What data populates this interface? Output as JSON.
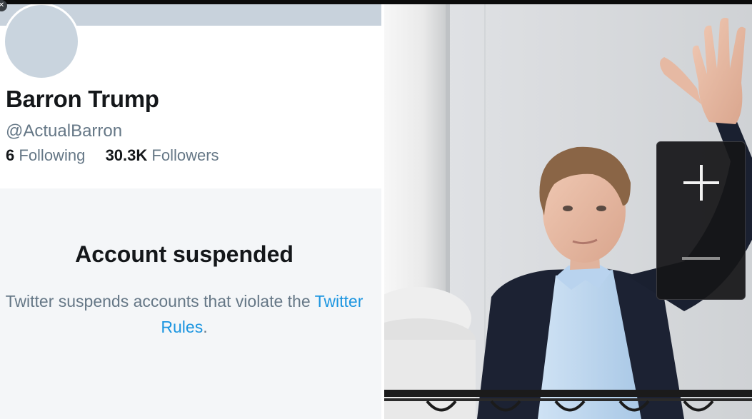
{
  "profile": {
    "display_name": "Barron Trump",
    "handle": "@ActualBarron",
    "following_count": "6",
    "following_label": "Following",
    "followers_count": "30.3K",
    "followers_label": "Followers"
  },
  "notice": {
    "title": "Account suspended",
    "body_prefix": "Twitter suspends accounts that violate the ",
    "link_text": "Twitter Rules",
    "body_suffix": "."
  },
  "controls": {
    "close_glyph": "✕",
    "zoom_in_icon": "plus-icon",
    "zoom_out_icon": "minus-icon"
  },
  "colors": {
    "link": "#1b95e0",
    "secondary_text": "#657786",
    "primary_text": "#14171a",
    "panel_bg": "#f4f6f8"
  }
}
